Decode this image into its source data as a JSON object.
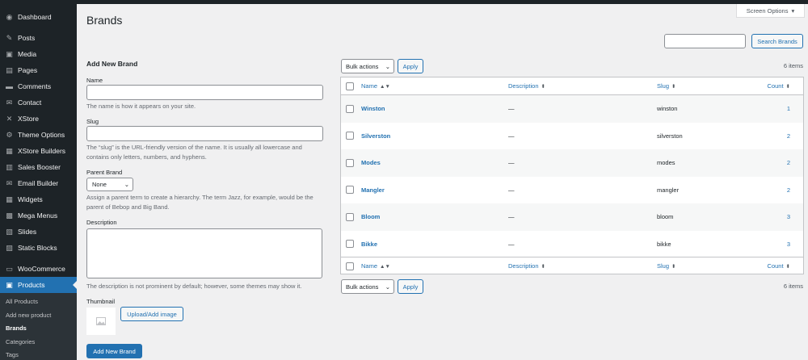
{
  "sidebar": {
    "items": [
      {
        "label": "Dashboard",
        "icon": "dashboard-icon"
      },
      {
        "label": "Posts",
        "icon": "pin-icon"
      },
      {
        "label": "Media",
        "icon": "media-icon"
      },
      {
        "label": "Pages",
        "icon": "pages-icon"
      },
      {
        "label": "Comments",
        "icon": "comment-icon"
      },
      {
        "label": "Contact",
        "icon": "mail-icon"
      },
      {
        "label": "XStore",
        "icon": "xstore-icon"
      },
      {
        "label": "Theme Options",
        "icon": "gear-icon"
      },
      {
        "label": "XStore Builders",
        "icon": "builder-icon"
      },
      {
        "label": "Sales Booster",
        "icon": "chart-icon"
      },
      {
        "label": "Email Builder",
        "icon": "email-icon"
      },
      {
        "label": "Widgets",
        "icon": "widgets-icon"
      },
      {
        "label": "Mega Menus",
        "icon": "mega-menu-icon"
      },
      {
        "label": "Slides",
        "icon": "slides-icon"
      },
      {
        "label": "Static Blocks",
        "icon": "blocks-icon"
      },
      {
        "label": "WooCommerce",
        "icon": "woocommerce-icon"
      },
      {
        "label": "Products",
        "icon": "products-icon"
      }
    ],
    "submenu": [
      "All Products",
      "Add new product",
      "Brands",
      "Categories",
      "Tags"
    ]
  },
  "header": {
    "screen_options": "Screen Options",
    "title": "Brands"
  },
  "search": {
    "button": "Search Brands",
    "value": ""
  },
  "form": {
    "heading": "Add New Brand",
    "name_label": "Name",
    "name_desc": "The name is how it appears on your site.",
    "slug_label": "Slug",
    "slug_desc": "The “slug” is the URL-friendly version of the name. It is usually all lowercase and contains only letters, numbers, and hyphens.",
    "parent_label": "Parent Brand",
    "parent_value": "None",
    "parent_desc": "Assign a parent term to create a hierarchy. The term Jazz, for example, would be the parent of Bebop and Big Band.",
    "description_label": "Description",
    "description_desc": "The description is not prominent by default; however, some themes may show it.",
    "thumbnail_label": "Thumbnail",
    "upload_button": "Upload/Add image",
    "submit_button": "Add New Brand"
  },
  "table": {
    "bulk_actions": "Bulk actions",
    "apply": "Apply",
    "items_count": "6 items",
    "columns": {
      "name": "Name",
      "description": "Description",
      "slug": "Slug",
      "count": "Count"
    },
    "rows": [
      {
        "name": "Winston",
        "description": "—",
        "slug": "winston",
        "count": "1"
      },
      {
        "name": "Silverston",
        "description": "—",
        "slug": "silverston",
        "count": "2"
      },
      {
        "name": "Modes",
        "description": "—",
        "slug": "modes",
        "count": "2"
      },
      {
        "name": "Mangler",
        "description": "—",
        "slug": "mangler",
        "count": "2"
      },
      {
        "name": "Bloom",
        "description": "—",
        "slug": "bloom",
        "count": "3"
      },
      {
        "name": "Bikke",
        "description": "—",
        "slug": "bikke",
        "count": "3"
      }
    ]
  },
  "colors": {
    "accent": "#2271b1",
    "sidebar": "#1d2327",
    "background": "#f0f0f1"
  }
}
